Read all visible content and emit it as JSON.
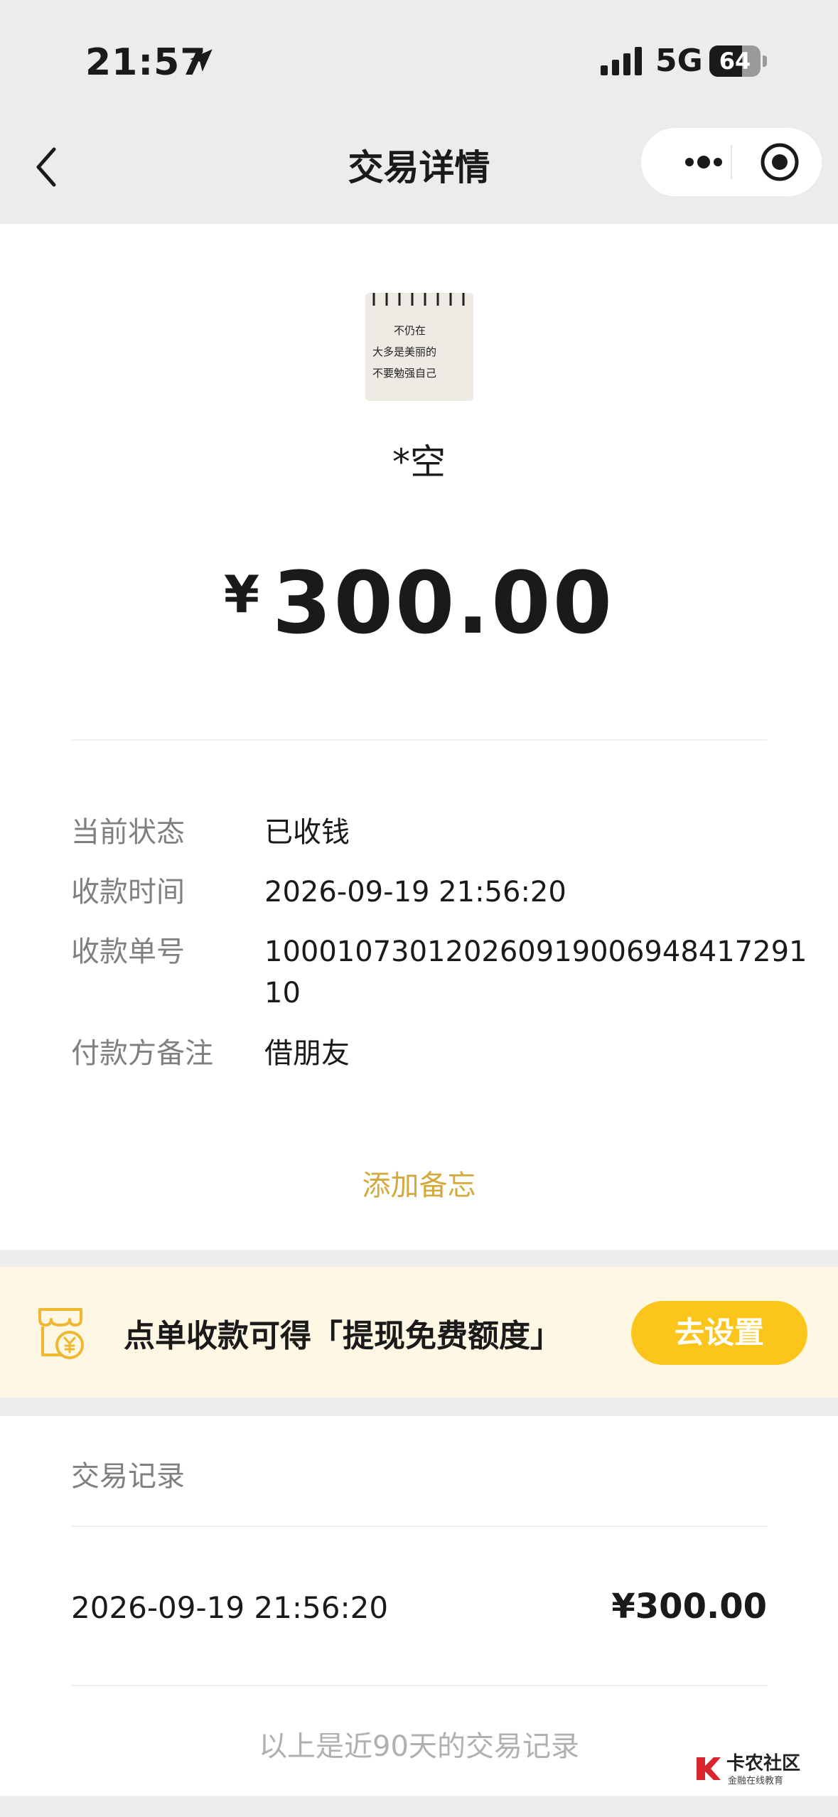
{
  "status_bar": {
    "time": "21:57",
    "network": "5G",
    "battery": "64",
    "battery_level": 0.64
  },
  "nav": {
    "title": "交易详情"
  },
  "payer": {
    "name": "*空",
    "avatar_text": [
      "不仍在",
      "大多是美丽的",
      "不要勉强自己"
    ]
  },
  "amount": {
    "symbol": "¥",
    "value": "300.00"
  },
  "details": [
    {
      "label": "当前状态",
      "value": "已收钱"
    },
    {
      "label": "收款时间",
      "value": "2026-09-19 21:56:20"
    },
    {
      "label": "收款单号",
      "value": "100010730120260919006948417291​10"
    },
    {
      "label": "付款方备注",
      "value": "借朋友"
    }
  ],
  "add_memo": "添加备忘",
  "banner": {
    "text": "点单收款可得「提现免费额度」",
    "button": "去设置"
  },
  "records": {
    "title": "交易记录",
    "items": [
      {
        "time": "2026-09-19 21:56:20",
        "amount": "¥300.00"
      }
    ],
    "footer": "以上是近90天的交易记录"
  },
  "watermark": {
    "title": "卡农社区",
    "subtitle": "金融在线教育"
  },
  "colors": {
    "accent": "#fbc51b",
    "memo": "#d4a93e",
    "banner_bg": "#fdf7e4"
  }
}
